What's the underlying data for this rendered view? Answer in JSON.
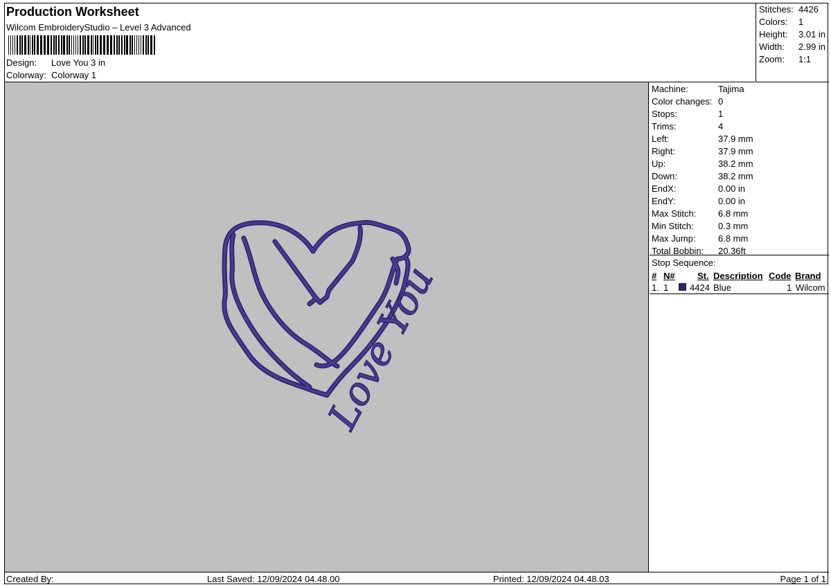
{
  "header": {
    "title": "Production Worksheet",
    "subtitle": "Wilcom EmbroideryStudio – Level 3 Advanced",
    "design_label": "Design:",
    "design_value": "Love You 3 in",
    "colorway_label": "Colorway:",
    "colorway_value": "Colorway 1"
  },
  "summary": [
    {
      "label": "Stitches:",
      "value": "4426"
    },
    {
      "label": "Colors:",
      "value": "1"
    },
    {
      "label": "Height:",
      "value": "3.01 in"
    },
    {
      "label": "Width:",
      "value": "2.99 in"
    },
    {
      "label": "Zoom:",
      "value": "1:1"
    }
  ],
  "machine_info": [
    {
      "label": "Machine:",
      "value": "Tajima"
    },
    {
      "label": "Color changes:",
      "value": "0"
    },
    {
      "label": "Stops:",
      "value": "1"
    },
    {
      "label": "Trims:",
      "value": "4"
    },
    {
      "label": "Left:",
      "value": "37.9 mm"
    },
    {
      "label": "Right:",
      "value": "37.9 mm"
    },
    {
      "label": "Up:",
      "value": "38.2 mm"
    },
    {
      "label": "Down:",
      "value": "38.2 mm"
    },
    {
      "label": "EndX:",
      "value": "0.00 in"
    },
    {
      "label": "EndY:",
      "value": "0.00 in"
    },
    {
      "label": "Max Stitch:",
      "value": "6.8 mm"
    },
    {
      "label": "Min Stitch:",
      "value": "0.3 mm"
    },
    {
      "label": "Max Jump:",
      "value": "6.8 mm"
    },
    {
      "label": "Total Bobbin:",
      "value": "20.36ft"
    }
  ],
  "stop_sequence": {
    "title": "Stop Sequence:",
    "headers": {
      "num": "#",
      "n": "N#",
      "st": "St.",
      "description": "Description",
      "code": "Code",
      "brand": "Brand"
    },
    "rows": [
      {
        "num": "1.",
        "n": "1",
        "color": "#2e2275",
        "st": "4424",
        "description": "Blue",
        "code": "1",
        "brand": "Wilcom"
      }
    ]
  },
  "design_preview": {
    "text": "Love You",
    "thread_color": "#4a3a8f",
    "outline_color": "#2a1d6a",
    "background": "#c0c0c0"
  },
  "footer": {
    "created_by": "Created By:",
    "last_saved": "Last Saved: 12/09/2024 04.48.00",
    "printed": "Printed: 12/09/2024 04.48.03",
    "page": "Page 1 of 1"
  }
}
